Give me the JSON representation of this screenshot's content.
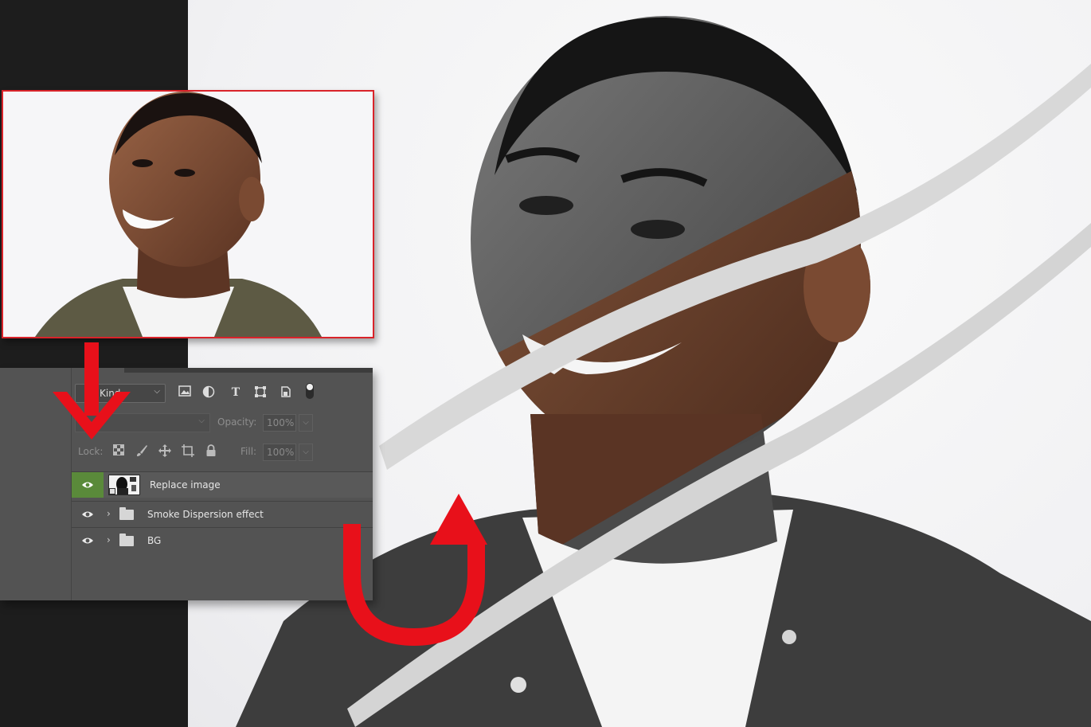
{
  "panel": {
    "kind_label": "Kind",
    "opacity_label": "Opacity:",
    "opacity_value": "100%",
    "lock_label": "Lock:",
    "fill_label": "Fill:",
    "fill_value": "100%"
  },
  "layers": [
    {
      "name": "Replace image",
      "type": "smart-object",
      "visible": true,
      "selected": true
    },
    {
      "name": "Smoke Dispersion effect",
      "type": "group",
      "visible": true,
      "selected": false
    },
    {
      "name": "BG",
      "type": "group",
      "visible": true,
      "selected": false
    }
  ],
  "icons": {
    "filter_pixel": "image-icon",
    "filter_adjustment": "half-circle-icon",
    "filter_type": "type-icon",
    "filter_shape": "shape-icon",
    "filter_smart": "smart-object-icon",
    "lock_transparent": "checker-icon",
    "lock_image": "brush-icon",
    "lock_position": "move-icon",
    "lock_artboard": "crop-icon",
    "lock_all": "lock-icon"
  },
  "colors": {
    "accent_red": "#e8101a",
    "eye_selected_bg": "#5a8a3a",
    "panel_bg": "#535353"
  }
}
